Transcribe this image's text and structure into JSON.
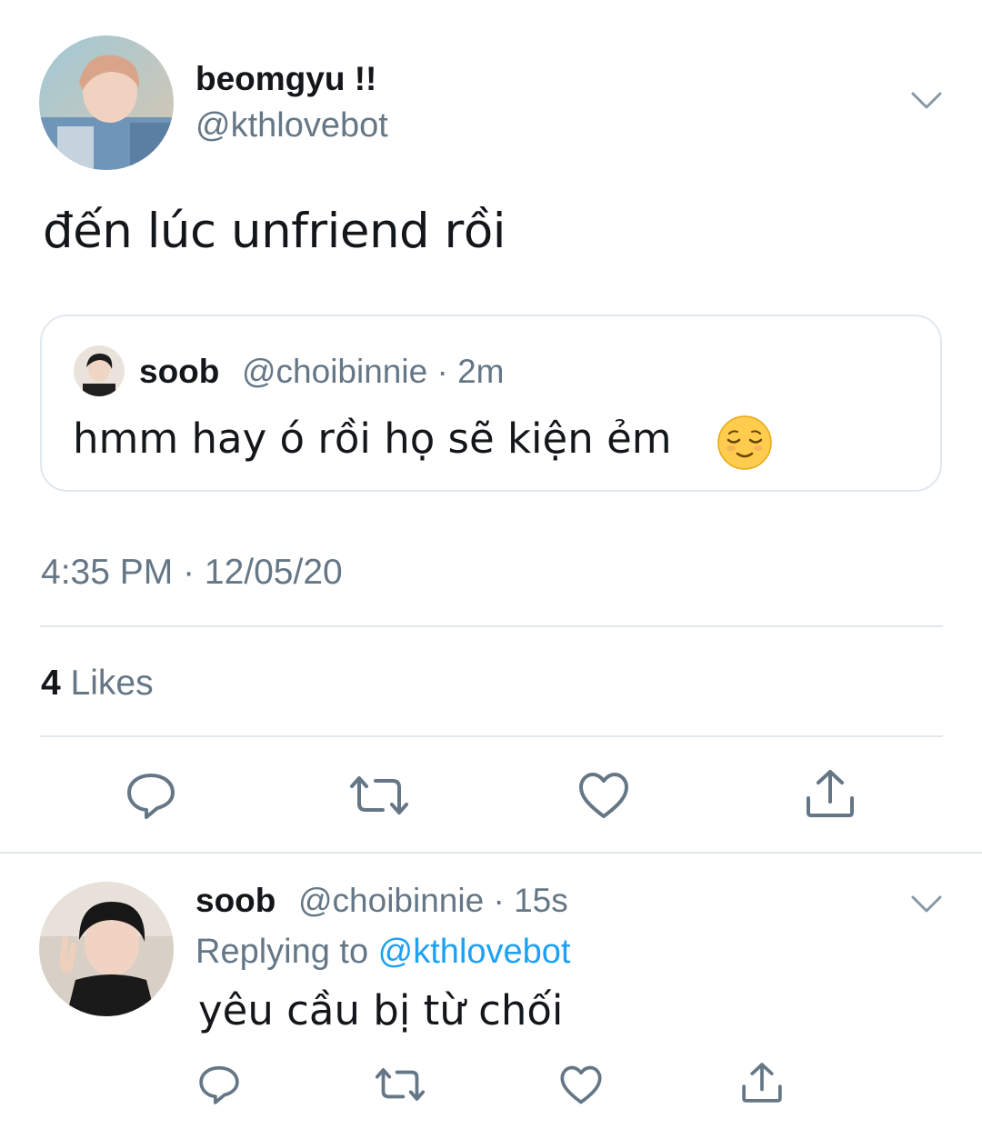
{
  "tweet": {
    "display_name": "beomgyu !!",
    "handle": "@kthlovebot",
    "text": "đến lúc unfriend rồi",
    "timestamp": "4:35 PM · 12/05/20",
    "likes_count": "4",
    "likes_label": " Likes"
  },
  "quoted_tweet": {
    "display_name": "soob",
    "handle_time": "@choibinnie · 2m",
    "text": "hmm hay ó rồi họ sẽ kiện ẻm",
    "emoji": "relieved-face-emoji"
  },
  "reply": {
    "display_name": "soob",
    "handle_time": "@choibinnie · 15s",
    "replying_prefix": "Replying to ",
    "replying_handle": "@kthlovebot",
    "text": "yêu cầu bị từ chối"
  },
  "icons": {
    "reply": "reply-icon",
    "retweet": "retweet-icon",
    "like": "heart-icon",
    "share": "share-icon",
    "more": "chevron-down-icon"
  },
  "colors": {
    "text_primary": "#14171a",
    "text_secondary": "#657786",
    "link": "#1da1f2",
    "border": "#e1e8ed"
  }
}
